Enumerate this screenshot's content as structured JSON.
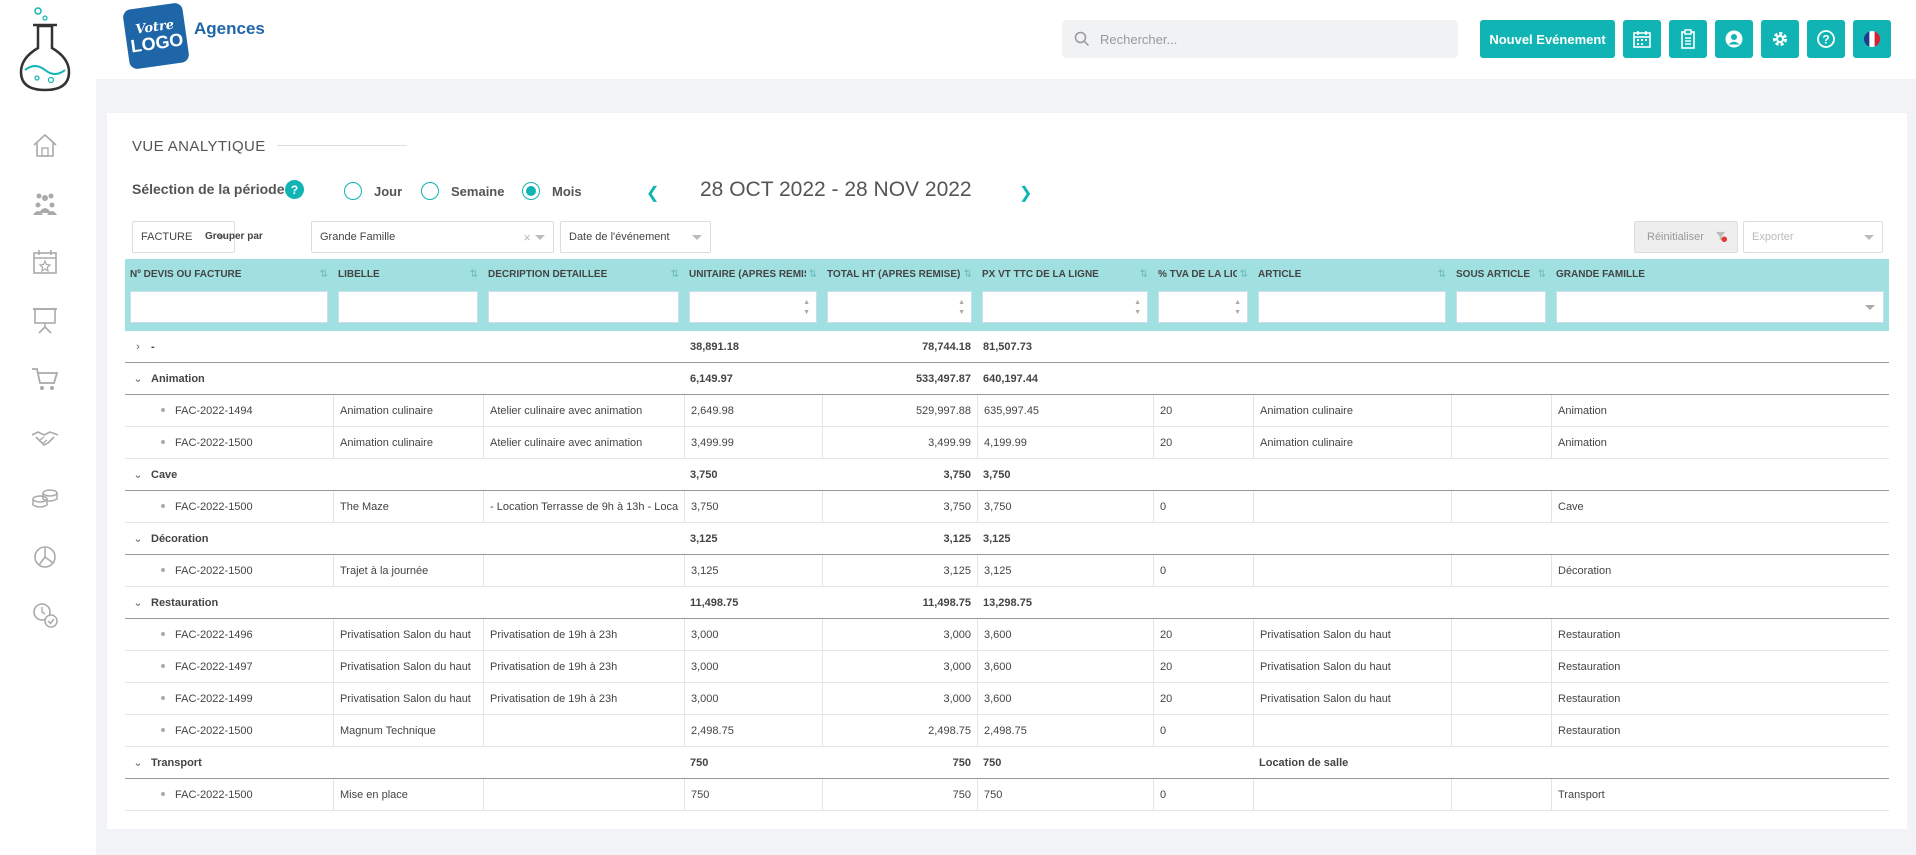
{
  "topbar": {
    "logo_small": "Votre",
    "logo_big": "LOGO",
    "logo_text": "Agences",
    "search_placeholder": "Rechercher...",
    "new_event": "Nouvel Evénement",
    "icons": [
      "calendar-icon",
      "clipboard-icon",
      "user-icon",
      "gear-icon",
      "help-icon",
      "french-flag-icon"
    ]
  },
  "sidebar": [
    "home-icon",
    "team-icon",
    "event-calendar-icon",
    "presentation-icon",
    "cart-icon",
    "handshake-icon",
    "coins-icon",
    "pie-chart-icon",
    "clock-check-icon"
  ],
  "page": {
    "title": "VUE ANALYTIQUE",
    "period_label": "Sélection de la période",
    "help": "?",
    "radios": [
      {
        "label": "Jour",
        "checked": false
      },
      {
        "label": "Semaine",
        "checked": false
      },
      {
        "label": "Mois",
        "checked": true
      }
    ],
    "date_range": "28 OCT 2022 - 28 NOV 2022"
  },
  "filters": {
    "doc_type": "FACTURE",
    "group_label": "Grouper par",
    "group_value": "Grande Famille",
    "date_type": "Date de l'événement",
    "reset": "Réinitialiser",
    "export": "Exporter"
  },
  "columns": [
    {
      "label": "Nº DEVIS OU FACTURE",
      "filter": "text"
    },
    {
      "label": "LIBELLE",
      "filter": "text"
    },
    {
      "label": "DECRIPTION DÉTAILLÉE",
      "filter": "text"
    },
    {
      "label": "UNITAIRE (APRÈS REMISE)",
      "filter": "number"
    },
    {
      "label": "TOTAL HT (APRÈS REMISE)",
      "filter": "number"
    },
    {
      "label": "PX VT TTC DE LA LIGNE",
      "filter": "number"
    },
    {
      "label": "% TVA DE LA LIGNE",
      "filter": "number"
    },
    {
      "label": "ARTICLE",
      "filter": "text"
    },
    {
      "label": "SOUS ARTICLE",
      "filter": "text"
    },
    {
      "label": "GRANDE FAMILLE",
      "filter": "select"
    }
  ],
  "rows": [
    {
      "type": "group",
      "expanded": false,
      "name": "-",
      "unit": "38,891.18",
      "total": "78,744.18",
      "ttc": "81,507.73",
      "article": ""
    },
    {
      "type": "group",
      "expanded": true,
      "name": "Animation",
      "unit": "6,149.97",
      "total": "533,497.87",
      "ttc": "640,197.44",
      "article": ""
    },
    {
      "type": "item",
      "num": "FAC-2022-1494",
      "lib": "Animation culinaire",
      "desc": "Atelier culinaire avec animation",
      "unit": "2,649.98",
      "total": "529,997.88",
      "ttc": "635,997.45",
      "tva": "20",
      "article": "Animation culinaire",
      "sous": "",
      "famille": "Animation"
    },
    {
      "type": "item",
      "num": "FAC-2022-1500",
      "lib": "Animation culinaire",
      "desc": "Atelier culinaire avec animation",
      "unit": "3,499.99",
      "total": "3,499.99",
      "ttc": "4,199.99",
      "tva": "20",
      "article": "Animation culinaire",
      "sous": "",
      "famille": "Animation"
    },
    {
      "type": "group",
      "expanded": true,
      "name": "Cave",
      "unit": "3,750",
      "total": "3,750",
      "ttc": "3,750",
      "article": ""
    },
    {
      "type": "item",
      "num": "FAC-2022-1500",
      "lib": "The Maze",
      "desc": "- Location Terrasse de 9h à 13h - Loca",
      "unit": "3,750",
      "total": "3,750",
      "ttc": "3,750",
      "tva": "0",
      "article": "",
      "sous": "",
      "famille": "Cave"
    },
    {
      "type": "group",
      "expanded": true,
      "name": "Décoration",
      "unit": "3,125",
      "total": "3,125",
      "ttc": "3,125",
      "article": ""
    },
    {
      "type": "item",
      "num": "FAC-2022-1500",
      "lib": "Trajet à la journée",
      "desc": "",
      "unit": "3,125",
      "total": "3,125",
      "ttc": "3,125",
      "tva": "0",
      "article": "",
      "sous": "",
      "famille": "Décoration"
    },
    {
      "type": "group",
      "expanded": true,
      "name": "Restauration",
      "unit": "11,498.75",
      "total": "11,498.75",
      "ttc": "13,298.75",
      "article": ""
    },
    {
      "type": "item",
      "num": "FAC-2022-1496",
      "lib": "Privatisation Salon du haut",
      "desc": "Privatisation de 19h à 23h",
      "unit": "3,000",
      "total": "3,000",
      "ttc": "3,600",
      "tva": "20",
      "article": "Privatisation Salon du haut",
      "sous": "",
      "famille": "Restauration"
    },
    {
      "type": "item",
      "num": "FAC-2022-1497",
      "lib": "Privatisation Salon du haut",
      "desc": "Privatisation de 19h à 23h",
      "unit": "3,000",
      "total": "3,000",
      "ttc": "3,600",
      "tva": "20",
      "article": "Privatisation Salon du haut",
      "sous": "",
      "famille": "Restauration"
    },
    {
      "type": "item",
      "num": "FAC-2022-1499",
      "lib": "Privatisation Salon du haut",
      "desc": "Privatisation de 19h à 23h",
      "unit": "3,000",
      "total": "3,000",
      "ttc": "3,600",
      "tva": "20",
      "article": "Privatisation Salon du haut",
      "sous": "",
      "famille": "Restauration"
    },
    {
      "type": "item",
      "num": "FAC-2022-1500",
      "lib": "Magnum Technique",
      "desc": "",
      "unit": "2,498.75",
      "total": "2,498.75",
      "ttc": "2,498.75",
      "tva": "0",
      "article": "",
      "sous": "",
      "famille": "Restauration"
    },
    {
      "type": "group",
      "expanded": true,
      "name": "Transport",
      "unit": "750",
      "total": "750",
      "ttc": "750",
      "article": "Location de salle"
    },
    {
      "type": "item",
      "num": "FAC-2022-1500",
      "lib": "Mise en place",
      "desc": "",
      "unit": "750",
      "total": "750",
      "ttc": "750",
      "tva": "0",
      "article": "",
      "sous": "",
      "famille": "Transport"
    }
  ],
  "colors": {
    "accent": "#11b4b4",
    "header_bg": "#a0e0e0"
  }
}
